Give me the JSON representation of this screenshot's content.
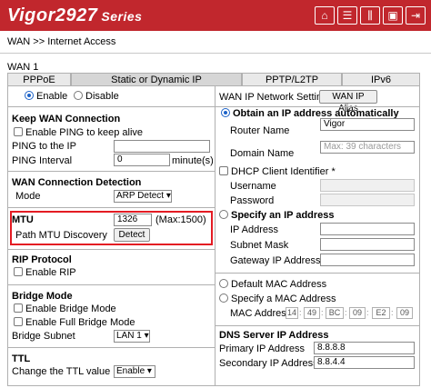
{
  "header": {
    "brand": "Vigor2927",
    "series": "Series",
    "icons": [
      "home-icon",
      "list-icon",
      "sliders-icon",
      "save-icon",
      "logout-icon"
    ]
  },
  "breadcrumb": "WAN >> Internet Access",
  "wan_title": "WAN 1",
  "tabs": [
    "PPPoE",
    "Static or Dynamic IP",
    "PPTP/L2TP",
    "IPv6"
  ],
  "left": {
    "enable_label": "Enable",
    "disable_label": "Disable",
    "keep_wan": {
      "title": "Keep WAN Connection",
      "enable_ping_label": "Enable PING to keep alive",
      "ping_to_ip_label": "PING to the IP",
      "ping_to_ip_value": "",
      "ping_interval_label": "PING Interval",
      "ping_interval_value": "0",
      "ping_interval_unit": "minute(s)"
    },
    "detection": {
      "title": "WAN Connection Detection",
      "mode_label": "Mode",
      "mode_value": "ARP Detect"
    },
    "mtu": {
      "title": "MTU",
      "value": "1326",
      "max_text": "(Max:1500)",
      "path_label": "Path MTU Discovery",
      "detect_button": "Detect"
    },
    "rip": {
      "title": "RIP Protocol",
      "enable_label": "Enable RIP"
    },
    "bridge": {
      "title": "Bridge Mode",
      "enable_label": "Enable Bridge Mode",
      "full_label": "Enable Full Bridge Mode",
      "subnet_label": "Bridge Subnet",
      "subnet_value": "LAN 1"
    },
    "ttl": {
      "title": "TTL",
      "change_label": "Change the TTL value",
      "value": "Enable"
    }
  },
  "right": {
    "settings_title": "WAN IP Network Settings",
    "alias_button": "WAN IP Alias",
    "obtain_label": "Obtain an IP address automatically",
    "router_name_label": "Router Name",
    "router_name_value": "Vigor",
    "domain_name_label": "Domain Name",
    "domain_name_placeholder": "Max: 39 characters",
    "dhcp_label": "DHCP Client Identifier",
    "dhcp_asterisk": "*",
    "username_label": "Username",
    "password_label": "Password",
    "specify_label": "Specify an IP address",
    "ip_label": "IP Address",
    "subnet_label": "Subnet Mask",
    "gateway_label": "Gateway IP Address",
    "default_mac_label": "Default MAC Address",
    "specify_mac_label": "Specify a MAC Address",
    "mac_label": "MAC Address:",
    "mac_segments": [
      "14",
      "49",
      "BC",
      "09",
      "E2",
      "09"
    ],
    "mac_separator": ":",
    "dns_title": "DNS Server IP Address",
    "primary_label": "Primary IP Address",
    "primary_value": "8.8.8.8",
    "secondary_label": "Secondary IP Address",
    "secondary_value": "8.8.4.4"
  },
  "colors": {
    "header": "#c1272d",
    "highlight": "#e41b23",
    "radio": "#1e63c8"
  }
}
